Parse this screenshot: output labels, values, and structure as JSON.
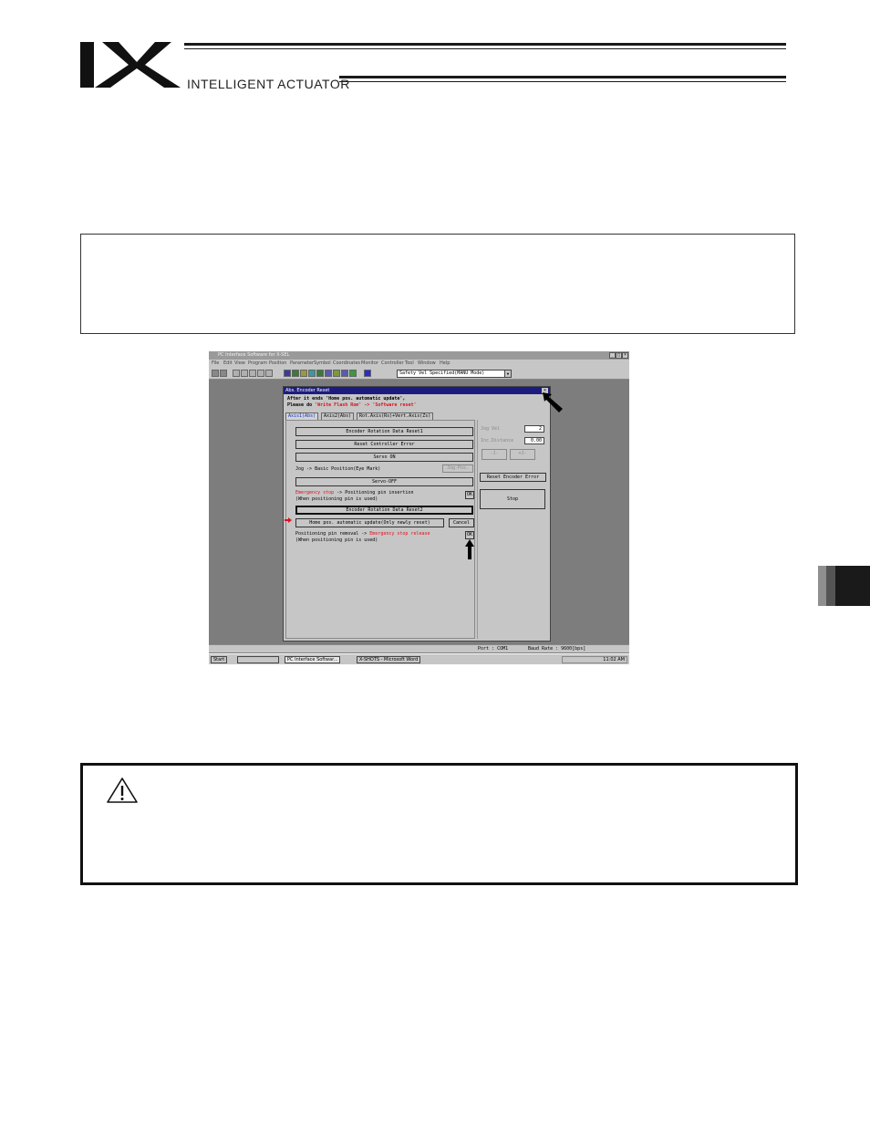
{
  "header": {
    "logo_text": "IX",
    "brand": "INTELLIGENT ACTUATOR"
  },
  "screenshot": {
    "window_title": "PC Interface Software for X-SEL",
    "menu": [
      "File",
      "Edit",
      "View",
      "Program",
      "Position",
      "Parameter",
      "Symbol",
      "Coordinates",
      "Monitor",
      "Controller",
      "Tool",
      "Window",
      "Help"
    ],
    "mode_select": "Safety Vel Specified(MANU Mode)",
    "dialog": {
      "title": "Abs. Encoder Reset",
      "message_line1": "After it ends 'Home pos. automatic update',",
      "message_line2_prefix": "Please do ",
      "message_line2_red": "'Write Flash Rom' -> 'Software reset'",
      "tabs": [
        "Axis1(Abs)",
        "Axis2(Abs)",
        "Rot.Axis(Rs)+Vert.Axis(Zs)"
      ],
      "buttons": {
        "encoder_rotation_reset1": "Encoder Rotation Data Reset1",
        "reset_controller_error": "Reset Controller Error",
        "servo_on": "Servo ON",
        "jog_label": "Jog -> Basic Position(Eye Mark)",
        "jog_button": "Jog-Pos.",
        "servo_off": "Servo-OFF",
        "emergency_red": "Emergency stop",
        "emergency_rest": " -> Positioning pin insertion",
        "emergency_note": "(When positioning pin is used)",
        "ok1": "OK",
        "encoder_rotation_reset2": "Encoder Rotation Data Reset2",
        "home_update": "Home pos. automatic update(Only newly reset)",
        "cancel": "Cancel",
        "removal_text": "Positioning pin removal -> ",
        "removal_red": "Emergency stop release",
        "removal_note": "(When positioning pin is used)",
        "ok2": "OK"
      },
      "right_panel": {
        "jog_vel_label": "Jog Vel",
        "jog_vel_value": "2",
        "inc_distance_label": "Inc.Distance",
        "inc_distance_value": "0.00",
        "minus_button": "-J-",
        "plus_button": "+J-",
        "reset_encoder_error": "Reset Encoder Error",
        "stop": "Stop"
      }
    },
    "status": {
      "port": "Port : COM1",
      "baud": "Baud Rate : 9600[bps]"
    },
    "taskbar": {
      "start": "Start",
      "task1": "PC Interface Softwar...",
      "task2": "X-SHOTS - Microsoft Word",
      "clock": "11:02 AM"
    }
  },
  "colors": {
    "accent_red": "#e0101a",
    "dialog_title": "#1c1c80"
  }
}
